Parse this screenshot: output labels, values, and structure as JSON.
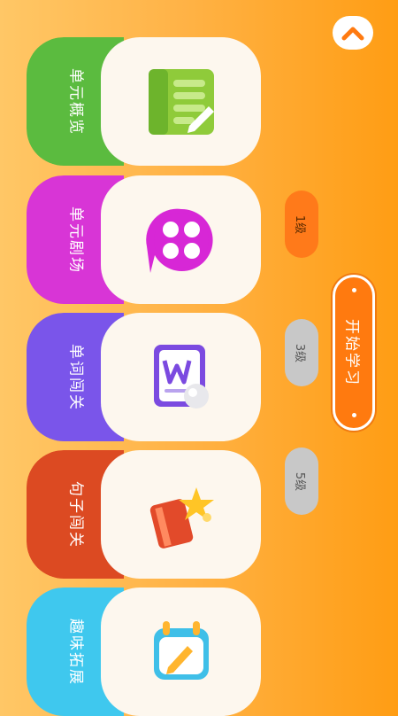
{
  "modules": [
    {
      "id": "overview",
      "label": "单元概览",
      "color": "#5bbb3f",
      "icon": "book-pencil-icon"
    },
    {
      "id": "theater",
      "label": "单元剧场",
      "color": "#d835d6",
      "icon": "film-reel-icon"
    },
    {
      "id": "word",
      "label": "单词闯关",
      "color": "#7a55ea",
      "icon": "word-doc-icon"
    },
    {
      "id": "sentence",
      "label": "句子闯关",
      "color": "#dc4a22",
      "icon": "book-star-icon"
    },
    {
      "id": "fun",
      "label": "趣味拓展",
      "color": "#3fc8ee",
      "icon": "calendar-pencil-icon"
    }
  ],
  "levels": [
    {
      "label": "1级",
      "state": "active",
      "bg": "#ff7a1a",
      "fg": "#5a2a00"
    },
    {
      "label": "3级",
      "state": "locked",
      "bg": "#c8c8c8",
      "fg": "#555555"
    },
    {
      "label": "5级",
      "state": "locked",
      "bg": "#c8c8c8",
      "fg": "#555555"
    }
  ],
  "start_button": {
    "label": "开始学习"
  },
  "top_button": {
    "icon": "chevron-up-icon"
  }
}
